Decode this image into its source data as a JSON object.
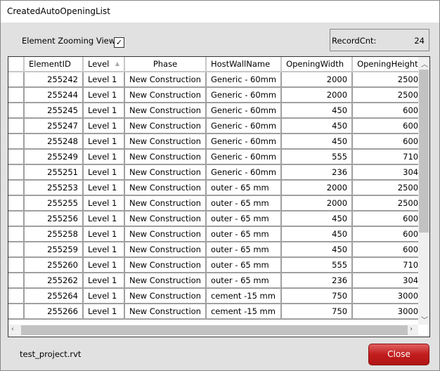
{
  "window": {
    "title": "CreatedAutoOpeningList"
  },
  "options": {
    "zoom_label": "Element Zooming View",
    "zoom_checked": true
  },
  "record": {
    "label": "RecordCnt:",
    "count": "24"
  },
  "grid": {
    "columns": [
      "ElementID",
      "Level",
      "Phase",
      "HostWallName",
      "OpeningWidth",
      "OpeningHeight"
    ],
    "sorted_column": "Level",
    "rows": [
      [
        "255242",
        "Level 1",
        "New Construction",
        "Generic - 60mm",
        "2000",
        "2500"
      ],
      [
        "255244",
        "Level 1",
        "New Construction",
        "Generic - 60mm",
        "2000",
        "2500"
      ],
      [
        "255245",
        "Level 1",
        "New Construction",
        "Generic - 60mm",
        "450",
        "600"
      ],
      [
        "255247",
        "Level 1",
        "New Construction",
        "Generic - 60mm",
        "450",
        "600"
      ],
      [
        "255248",
        "Level 1",
        "New Construction",
        "Generic - 60mm",
        "450",
        "600"
      ],
      [
        "255249",
        "Level 1",
        "New Construction",
        "Generic - 60mm",
        "555",
        "710"
      ],
      [
        "255251",
        "Level 1",
        "New Construction",
        "Generic - 60mm",
        "236",
        "304"
      ],
      [
        "255253",
        "Level 1",
        "New Construction",
        "outer - 65 mm",
        "2000",
        "2500"
      ],
      [
        "255255",
        "Level 1",
        "New Construction",
        "outer - 65 mm",
        "2000",
        "2500"
      ],
      [
        "255256",
        "Level 1",
        "New Construction",
        "outer - 65 mm",
        "450",
        "600"
      ],
      [
        "255258",
        "Level 1",
        "New Construction",
        "outer - 65 mm",
        "450",
        "600"
      ],
      [
        "255259",
        "Level 1",
        "New Construction",
        "outer - 65 mm",
        "450",
        "600"
      ],
      [
        "255260",
        "Level 1",
        "New Construction",
        "outer - 65 mm",
        "555",
        "710"
      ],
      [
        "255262",
        "Level 1",
        "New Construction",
        "outer - 65 mm",
        "236",
        "304"
      ],
      [
        "255264",
        "Level 1",
        "New Construction",
        "cement -15 mm",
        "750",
        "3000"
      ],
      [
        "255266",
        "Level 1",
        "New Construction",
        "cement -15 mm",
        "750",
        "3000"
      ]
    ]
  },
  "footer": {
    "file": "test_project.rvt",
    "close_label": "Close"
  },
  "colors": {
    "close_button": "#c21d1d",
    "gridline": "#a0a0a0"
  }
}
